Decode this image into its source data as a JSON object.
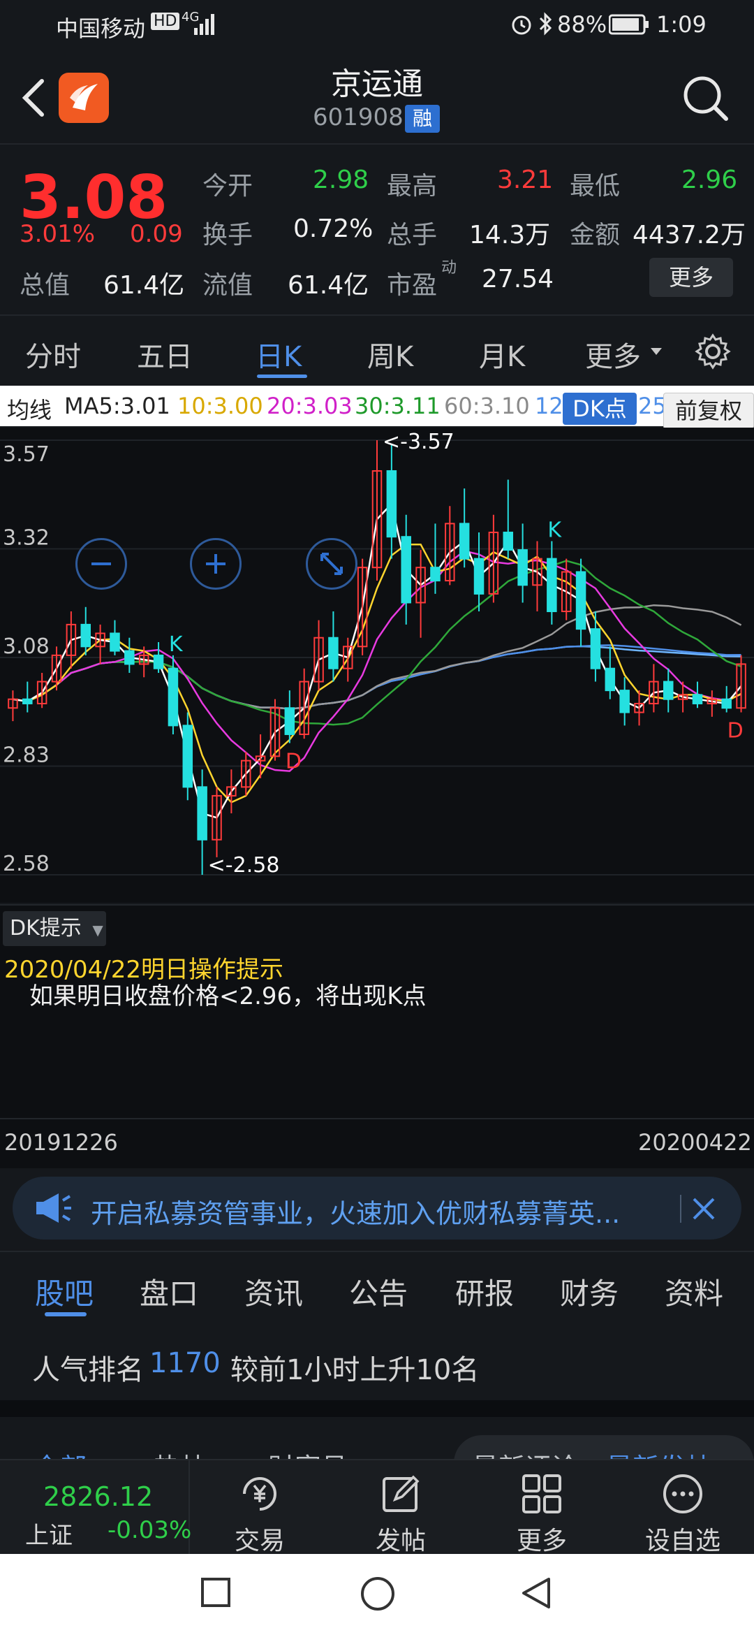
{
  "status_bar": {
    "carrier": "中国移动",
    "network_badge": "HD",
    "network_type": "4G",
    "battery": "88%",
    "time": "1:09"
  },
  "header": {
    "title": "京运通",
    "code": "601908",
    "badge": "融"
  },
  "quote": {
    "price": "3.08",
    "change_pct": "3.01%",
    "change": "0.09",
    "open_label": "今开",
    "open": "2.98",
    "high_label": "最高",
    "high": "3.21",
    "low_label": "最低",
    "low": "2.96",
    "turnover_label": "换手",
    "turnover": "0.72%",
    "volume_label": "总手",
    "volume": "14.3万",
    "amount_label": "金额",
    "amount": "4437.2万",
    "mktcap_label": "总值",
    "mktcap": "61.4亿",
    "float_label": "流值",
    "float": "61.4亿",
    "pe_label": "市盈",
    "pe_sup": "动",
    "pe": "27.54",
    "more_button": "更多"
  },
  "chart_tabs": [
    "分时",
    "五日",
    "日K",
    "周K",
    "月K",
    "更多"
  ],
  "active_chart_tab": "日K",
  "ma_legend": {
    "label": "均线",
    "ma5": "MA5:3.01",
    "ma10": "10:3.00",
    "ma20": "20:3.03",
    "ma30": "30:3.11",
    "ma60": "60:3.10",
    "ma120": "12",
    "dk_button": "DK点",
    "ma250": "25",
    "adjust_button": "前复权"
  },
  "colors": {
    "up": "#ff3b3b",
    "down": "#2fcf4a",
    "down_candle": "#25e0e0",
    "ma5": "#ffffff",
    "ma10": "#ffd52e",
    "ma20": "#e83ae0",
    "ma30": "#2fa83a",
    "ma60": "#9a9a9a",
    "ma120": "#4f8fe8",
    "ma250": "#6fb6ff",
    "accent": "#4f8fe8"
  },
  "chart_data": {
    "type": "candlestick",
    "y_ticks": [
      "3.57",
      "3.32",
      "3.08",
      "2.83",
      "2.58"
    ],
    "ylim": [
      2.58,
      3.57
    ],
    "high_annotation": "<-3.57",
    "low_annotation": "<-2.58",
    "markers": [
      "K",
      "D",
      "K",
      "D"
    ],
    "candles": [
      {
        "o": 2.96,
        "h": 3.0,
        "l": 2.93,
        "c": 2.98
      },
      {
        "o": 2.98,
        "h": 3.02,
        "l": 2.95,
        "c": 2.97
      },
      {
        "o": 2.97,
        "h": 3.04,
        "l": 2.96,
        "c": 3.02
      },
      {
        "o": 3.02,
        "h": 3.1,
        "l": 3.0,
        "c": 3.08
      },
      {
        "o": 3.08,
        "h": 3.18,
        "l": 3.05,
        "c": 3.15
      },
      {
        "o": 3.15,
        "h": 3.19,
        "l": 3.08,
        "c": 3.1
      },
      {
        "o": 3.1,
        "h": 3.15,
        "l": 3.06,
        "c": 3.13
      },
      {
        "o": 3.13,
        "h": 3.16,
        "l": 3.08,
        "c": 3.09
      },
      {
        "o": 3.09,
        "h": 3.12,
        "l": 3.04,
        "c": 3.06
      },
      {
        "o": 3.06,
        "h": 3.1,
        "l": 3.03,
        "c": 3.08
      },
      {
        "o": 3.08,
        "h": 3.11,
        "l": 3.04,
        "c": 3.05
      },
      {
        "o": 3.05,
        "h": 3.08,
        "l": 2.9,
        "c": 2.92
      },
      {
        "o": 2.92,
        "h": 2.95,
        "l": 2.75,
        "c": 2.78
      },
      {
        "o": 2.78,
        "h": 2.82,
        "l": 2.58,
        "c": 2.66
      },
      {
        "o": 2.66,
        "h": 2.78,
        "l": 2.62,
        "c": 2.76
      },
      {
        "o": 2.76,
        "h": 2.82,
        "l": 2.72,
        "c": 2.78
      },
      {
        "o": 2.78,
        "h": 2.86,
        "l": 2.76,
        "c": 2.84
      },
      {
        "o": 2.84,
        "h": 2.9,
        "l": 2.8,
        "c": 2.85
      },
      {
        "o": 2.85,
        "h": 2.98,
        "l": 2.84,
        "c": 2.96
      },
      {
        "o": 2.96,
        "h": 3.0,
        "l": 2.88,
        "c": 2.9
      },
      {
        "o": 2.9,
        "h": 3.05,
        "l": 2.89,
        "c": 3.02
      },
      {
        "o": 3.02,
        "h": 3.16,
        "l": 3.0,
        "c": 3.12
      },
      {
        "o": 3.12,
        "h": 3.18,
        "l": 3.02,
        "c": 3.05
      },
      {
        "o": 3.05,
        "h": 3.12,
        "l": 3.02,
        "c": 3.1
      },
      {
        "o": 3.1,
        "h": 3.3,
        "l": 3.08,
        "c": 3.28
      },
      {
        "o": 3.28,
        "h": 3.57,
        "l": 3.25,
        "c": 3.5
      },
      {
        "o": 3.5,
        "h": 3.56,
        "l": 3.3,
        "c": 3.35
      },
      {
        "o": 3.35,
        "h": 3.4,
        "l": 3.15,
        "c": 3.2
      },
      {
        "o": 3.2,
        "h": 3.32,
        "l": 3.12,
        "c": 3.28
      },
      {
        "o": 3.28,
        "h": 3.38,
        "l": 3.22,
        "c": 3.25
      },
      {
        "o": 3.25,
        "h": 3.42,
        "l": 3.24,
        "c": 3.38
      },
      {
        "o": 3.38,
        "h": 3.46,
        "l": 3.28,
        "c": 3.3
      },
      {
        "o": 3.3,
        "h": 3.36,
        "l": 3.18,
        "c": 3.22
      },
      {
        "o": 3.22,
        "h": 3.4,
        "l": 3.2,
        "c": 3.36
      },
      {
        "o": 3.36,
        "h": 3.48,
        "l": 3.3,
        "c": 3.32
      },
      {
        "o": 3.32,
        "h": 3.38,
        "l": 3.2,
        "c": 3.24
      },
      {
        "o": 3.24,
        "h": 3.34,
        "l": 3.18,
        "c": 3.3
      },
      {
        "o": 3.3,
        "h": 3.34,
        "l": 3.15,
        "c": 3.18
      },
      {
        "o": 3.18,
        "h": 3.3,
        "l": 3.16,
        "c": 3.27
      },
      {
        "o": 3.27,
        "h": 3.3,
        "l": 3.1,
        "c": 3.14
      },
      {
        "o": 3.14,
        "h": 3.18,
        "l": 3.02,
        "c": 3.05
      },
      {
        "o": 3.05,
        "h": 3.1,
        "l": 2.98,
        "c": 3.0
      },
      {
        "o": 3.0,
        "h": 3.03,
        "l": 2.92,
        "c": 2.95
      },
      {
        "o": 2.95,
        "h": 3.0,
        "l": 2.92,
        "c": 2.97
      },
      {
        "o": 2.97,
        "h": 3.06,
        "l": 2.95,
        "c": 3.02
      },
      {
        "o": 3.02,
        "h": 3.05,
        "l": 2.95,
        "c": 2.98
      },
      {
        "o": 2.98,
        "h": 3.02,
        "l": 2.95,
        "c": 2.99
      },
      {
        "o": 2.99,
        "h": 3.02,
        "l": 2.96,
        "c": 2.97
      },
      {
        "o": 2.97,
        "h": 3.0,
        "l": 2.94,
        "c": 2.98
      },
      {
        "o": 2.98,
        "h": 3.01,
        "l": 2.95,
        "c": 2.96
      },
      {
        "o": 2.96,
        "h": 3.08,
        "l": 2.95,
        "c": 3.06
      }
    ],
    "x_start": "20191226",
    "x_end": "20200422"
  },
  "chart_controls": {
    "zoom_out": "minus-icon",
    "zoom_in": "plus-icon",
    "fullscreen": "expand-icon"
  },
  "dk": {
    "select_label": "DK提示",
    "date_line": "2020/04/22明日操作提示",
    "hint": "如果明日收盘价格<2.96，将出现K点"
  },
  "dates": {
    "start": "20191226",
    "end": "20200422"
  },
  "ad": {
    "text": "开启私募资管事业，火速加入优财私募菁英..."
  },
  "lower_tabs": [
    "股吧",
    "盘口",
    "资讯",
    "公告",
    "研报",
    "财务",
    "资料"
  ],
  "active_lower_tab": "股吧",
  "rank": {
    "prefix": "人气排名",
    "value": "1170",
    "suffix": "较前1小时上升10名"
  },
  "sub_tabs": [
    "全部",
    "热帖",
    "财富号",
    "最新评论",
    "最新发帖"
  ],
  "index": {
    "value": "2826.12",
    "name": "上证",
    "change": "-0.03%"
  },
  "bottom_nav": [
    "交易",
    "发帖",
    "更多",
    "设自选"
  ]
}
